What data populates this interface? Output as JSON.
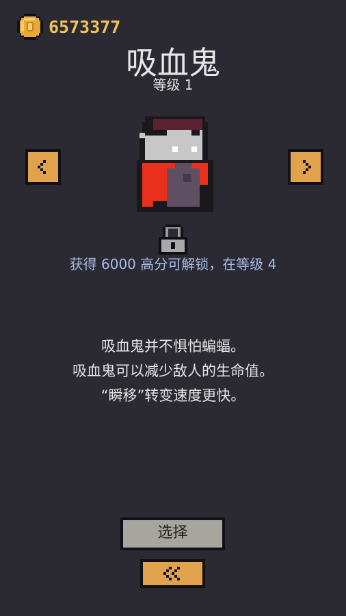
{
  "coins": {
    "count": "6573377",
    "icon": "coin-icon"
  },
  "character": {
    "name": "吸血鬼",
    "level": "等级 1",
    "sprite": "vampire-sprite"
  },
  "unlock": {
    "icon": "lock-icon",
    "text": "获得 6000 高分可解锁，在等级 4"
  },
  "description": [
    "吸血鬼并不惧怕蝙蝠。",
    "吸血鬼可以减少敌人的生命值。",
    "“瞬移”转变速度更快。"
  ],
  "buttons": {
    "prev": "prev-arrow",
    "next": "next-arrow",
    "select": "选择",
    "back": "back-double-arrow"
  },
  "colors": {
    "background": "#2b2a33",
    "accent": "#e0a24c",
    "coin_text": "#f0c25a",
    "unlock_text": "#a8bde8"
  }
}
